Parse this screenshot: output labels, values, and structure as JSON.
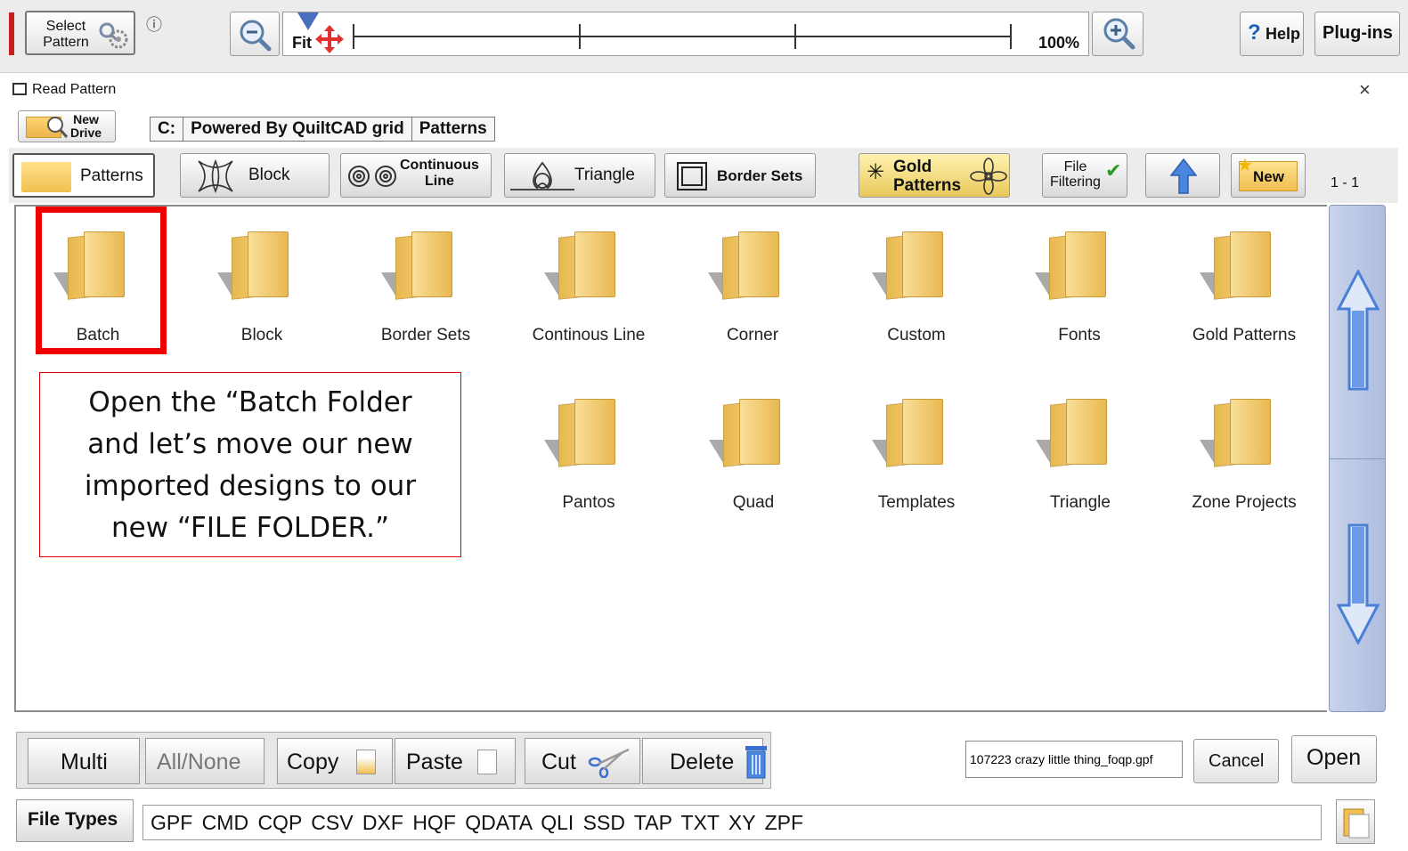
{
  "toolbar": {
    "select_pattern_label_1": "Select",
    "select_pattern_label_2": "Pattern",
    "info_symbol": "ⓘ",
    "fit_label": "Fit",
    "zoom_value": "100%",
    "help_label": "Help",
    "help_symbol": "?",
    "plugins_label": "Plug-ins"
  },
  "dialog": {
    "title": "Read Pattern",
    "close_symbol": "×"
  },
  "drive": {
    "new_drive_line1": "New",
    "new_drive_line2": "Drive",
    "path": [
      "C:",
      "Powered By QuiltCAD grid",
      "Patterns"
    ]
  },
  "categories": {
    "patterns": "Patterns",
    "block": "Block",
    "continuous_1": "Continuous",
    "continuous_2": "Line",
    "triangle": "Triangle",
    "border_sets": "Border Sets",
    "gold_1": "Gold",
    "gold_2": "Patterns",
    "file_filter_1": "File",
    "file_filter_2": "Filtering",
    "new": "New",
    "page_indicator": "1 - 1"
  },
  "folders": [
    "Batch",
    "Block",
    "Border Sets",
    "Continous Line",
    "Corner",
    "Custom",
    "Fonts",
    "Gold Patterns",
    "Pantos",
    "Quad",
    "Templates",
    "Triangle",
    "Zone Projects"
  ],
  "callout": {
    "line1": "Open the “Batch Folder",
    "line2": "and let’s move our new",
    "line3": "imported designs to our",
    "line4": "new “FILE FOLDER.”"
  },
  "actions": {
    "multi": "Multi",
    "all_none": "All/None",
    "copy": "Copy",
    "paste": "Paste",
    "cut": "Cut",
    "delete": "Delete"
  },
  "filename": {
    "value": "107223 crazy little thing_foqp.gpf"
  },
  "buttons": {
    "cancel": "Cancel",
    "open": "Open"
  },
  "file_types": {
    "label": "File Types",
    "list": "GPF CMD CQP CSV DXF HQF QDATA QLI SSD TAP TXT XY ZPF"
  },
  "colors": {
    "highlight": "#ee0000",
    "folder": "#f2c660",
    "scrollbar": "#b8c6e6",
    "arrow": "#4a7fd6"
  }
}
